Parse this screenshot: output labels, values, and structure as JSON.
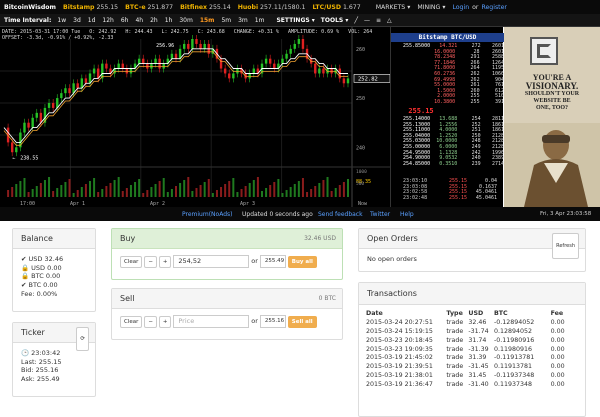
{
  "topbar": {
    "brand": "BitcoinWisdom",
    "tickers": [
      {
        "name": "Bitstamp",
        "value": "255.15"
      },
      {
        "name": "BTC-e",
        "value": "251.877"
      },
      {
        "name": "Bitfinex",
        "value": "255.14"
      },
      {
        "name": "Huobi",
        "value": "257.11/1580.1"
      },
      {
        "name": "LTC/USD",
        "value": "1.677"
      }
    ],
    "markets": "MARKETS ▾",
    "mining": "MINING ▾",
    "login": "Login",
    "or": "or",
    "register": "Register"
  },
  "intervals": {
    "label": "Time Interval:",
    "items": [
      "1w",
      "3d",
      "1d",
      "12h",
      "6h",
      "4h",
      "2h",
      "1h",
      "30m",
      "15m",
      "5m",
      "3m",
      "1m"
    ],
    "active": "15m",
    "settings": "SETTINGS ▾",
    "tools": "TOOLS ▾"
  },
  "chart_legend": {
    "line1": "DATE: 2015-03-31 17:00 Tue   O: 242.92   H: 244.43   L: 242.75   C: 243.68   CHANGE: +0.31 %   AMPLITUDE: 0.69 %   VOL: 264",
    "line2": "OFFSET: -3.3d, -0.91% / +0.92%, -2.33"
  },
  "chart_data": {
    "type": "line",
    "pair": "Bitstamp BTC/USD",
    "price_axis": [
      "260",
      "250",
      "240"
    ],
    "price_min": 236,
    "price_max": 262,
    "markers": {
      "high": "256.96",
      "low": "238.55",
      "current": "252.82",
      "volume_mark": "88.35"
    },
    "vol_axis": [
      "1000",
      "500"
    ],
    "x_labels": [
      "17:00",
      "Apr 1",
      "Apr 2",
      "Apr 3",
      "Now"
    ],
    "close": [
      244,
      241,
      239,
      240,
      243,
      245,
      244,
      246,
      247,
      245,
      248,
      249,
      248,
      250,
      251,
      252,
      251,
      253,
      252,
      254,
      253,
      255,
      256,
      254,
      257,
      256,
      255,
      256,
      257,
      256,
      255,
      256,
      257,
      258,
      257,
      256,
      257,
      258,
      256,
      257,
      258,
      259,
      258,
      260,
      261,
      260,
      262,
      261,
      260,
      261,
      259,
      260,
      258,
      256,
      255,
      254,
      255,
      256,
      255,
      254,
      255,
      256,
      255,
      257,
      258,
      257,
      256,
      257,
      258,
      259,
      260,
      261,
      262,
      260,
      258,
      257,
      255,
      256,
      255,
      256,
      255,
      256,
      254,
      253,
      254
    ],
    "ma": [
      244,
      243,
      242,
      241,
      241,
      242,
      243,
      244,
      244,
      245,
      246,
      247,
      247,
      248,
      249,
      250,
      250,
      251,
      252,
      252,
      253,
      253,
      254,
      254,
      255,
      255,
      255,
      256,
      256,
      256,
      256,
      256,
      256,
      257,
      257,
      257,
      257,
      257,
      257,
      257,
      257,
      258,
      258,
      258,
      259,
      259,
      260,
      260,
      260,
      260,
      260,
      260,
      259,
      258,
      258,
      257,
      256,
      256,
      256,
      255,
      255,
      255,
      255,
      256,
      256,
      256,
      256,
      256,
      257,
      257,
      258,
      258,
      259,
      259,
      259,
      258,
      258,
      257,
      257,
      256,
      256,
      256,
      255,
      255,
      255
    ]
  },
  "orderbook": {
    "title": "Bitstamp BTC/USD",
    "asks": [
      [
        "255.85000",
        "14.321",
        "272",
        "2601"
      ],
      [
        "",
        "16.0000",
        "28",
        "2601"
      ],
      [
        "",
        "78.2348",
        "291",
        "2588"
      ],
      [
        "",
        "77.1846",
        "266",
        "1264"
      ],
      [
        "",
        "71.8000",
        "264",
        "1195"
      ],
      [
        "",
        "60.2736",
        "262",
        "1066"
      ],
      [
        "",
        "69.4998",
        "262",
        "904"
      ],
      [
        "",
        "55.0000",
        "261",
        "761"
      ],
      [
        "",
        "1.5000",
        "260",
        "612"
      ],
      [
        "",
        "2.0000",
        "255",
        "510"
      ],
      [
        "",
        "10.3800",
        "255",
        "391"
      ]
    ],
    "mid": "255.15",
    "bids": [
      [
        "255.14000",
        "13.688",
        "254",
        "2811"
      ],
      [
        "255.13000",
        "1.2556",
        "252",
        "1861"
      ],
      [
        "255.11000",
        "4.0000",
        "251",
        "1861"
      ],
      [
        "255.04000",
        "1.2520",
        "250",
        "2128"
      ],
      [
        "255.03000",
        "10.0000",
        "248",
        "2128"
      ],
      [
        "255.00000",
        "6.0000",
        "249",
        "2128"
      ],
      [
        "254.95000",
        "1.1328",
        "242",
        "1996"
      ],
      [
        "254.90000",
        "9.0532",
        "240",
        "2389"
      ],
      [
        "254.85000",
        "0.3510",
        "239",
        "2714"
      ]
    ],
    "trades": [
      [
        "23:03:10",
        "255.15",
        "0.04"
      ],
      [
        "23:03:08",
        "255.15",
        "0.1637"
      ],
      [
        "23:02:58",
        "255.15",
        "45.0461"
      ],
      [
        "23:02:48",
        "255.15",
        "45.0461"
      ]
    ]
  },
  "ad": {
    "line1": "YOU'RE A",
    "line2": "VISIONARY.",
    "line3": "SHOULDN'T YOUR",
    "line4": "WEBSITE BE",
    "line5": "ONE, TOO?"
  },
  "statusbar": {
    "premium": "Premium(NoAds)",
    "updated": "Updated 0 seconds ago",
    "feedback": "Send feedback",
    "twitter": "Twitter",
    "help": "Help",
    "clock": "Fri, 3 Apr 23:03:58"
  },
  "balance": {
    "title": "Balance",
    "lines": [
      "USD 32.46",
      "USD 0.00",
      "BTC 0.00",
      "BTC 0.00"
    ],
    "fee": "Fee: 0.00%"
  },
  "ticker": {
    "title": "Ticker",
    "time": "23:03:42",
    "last": "Last: 255.15",
    "bid": "Bid: 255.16",
    "ask": "Ask: 255.49"
  },
  "buy": {
    "title": "Buy",
    "available": "32.46 USD",
    "clear": "Clear",
    "minus": "−",
    "plus": "+",
    "price": "254,52",
    "or": "or",
    "price2": "255.49",
    "all": "Buy all"
  },
  "sell": {
    "title": "Sell",
    "available": "0 BTC",
    "clear": "Clear",
    "minus": "−",
    "plus": "+",
    "placeholder": "Price",
    "or": "or",
    "price2": "255.16",
    "all": "Sell all"
  },
  "open_orders": {
    "title": "Open Orders",
    "refresh": "Refresh",
    "empty": "No open orders"
  },
  "transactions": {
    "title": "Transactions",
    "headers": [
      "Date",
      "Type",
      "USD",
      "BTC",
      "Fee"
    ],
    "rows": [
      [
        "2015-03-24 20:27:51",
        "trade",
        "32.46",
        "-0.12894052",
        "0.00"
      ],
      [
        "2015-03-24 15:19:15",
        "trade",
        "-31.74",
        "0.12894052",
        "0.00"
      ],
      [
        "2015-03-23 20:18:45",
        "trade",
        "31.74",
        "-0.11980916",
        "0.00"
      ],
      [
        "2015-03-23 19:09:35",
        "trade",
        "-31.39",
        "0.11980916",
        "0.00"
      ],
      [
        "2015-03-19 21:45:02",
        "trade",
        "31.39",
        "-0.11913781",
        "0.00"
      ],
      [
        "2015-03-19 21:39:51",
        "trade",
        "-31.45",
        "0.11913781",
        "0.00"
      ],
      [
        "2015-03-19 21:38:01",
        "trade",
        "31.45",
        "-0.11937348",
        "0.00"
      ],
      [
        "2015-03-19 21:36:47",
        "trade",
        "-31.40",
        "0.11937348",
        "0.00"
      ]
    ]
  }
}
